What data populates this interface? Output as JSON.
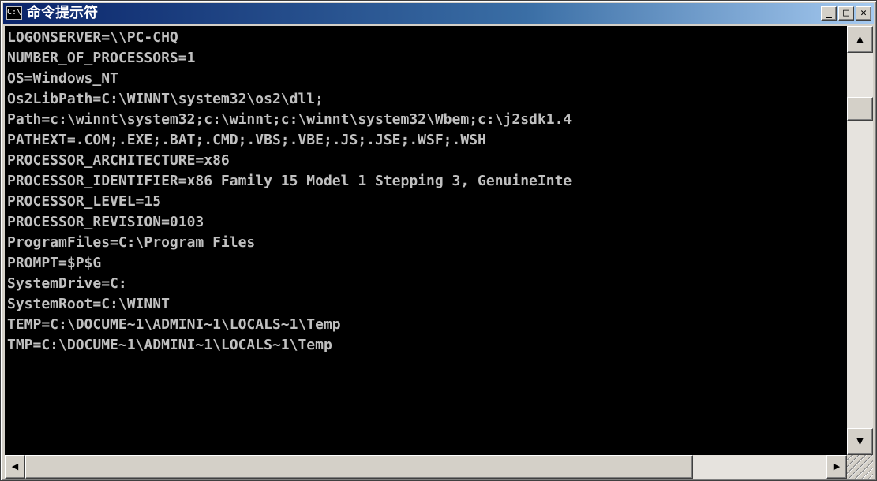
{
  "window": {
    "title": "命令提示符",
    "icon": "cmd-icon",
    "icon_glyph": "C:\\",
    "controls": {
      "minimize": "_",
      "maximize": "□",
      "close": "✕"
    }
  },
  "console": {
    "text_color": "#c0c0c0",
    "background": "#000000",
    "lines": [
      "LOGONSERVER=\\\\PC-CHQ",
      "NUMBER_OF_PROCESSORS=1",
      "OS=Windows_NT",
      "Os2LibPath=C:\\WINNT\\system32\\os2\\dll;",
      "Path=c:\\winnt\\system32;c:\\winnt;c:\\winnt\\system32\\Wbem;c:\\j2sdk1.4",
      "PATHEXT=.COM;.EXE;.BAT;.CMD;.VBS;.VBE;.JS;.JSE;.WSF;.WSH",
      "PROCESSOR_ARCHITECTURE=x86",
      "PROCESSOR_IDENTIFIER=x86 Family 15 Model 1 Stepping 3, GenuineInte",
      "PROCESSOR_LEVEL=15",
      "PROCESSOR_REVISION=0103",
      "ProgramFiles=C:\\Program Files",
      "PROMPT=$P$G",
      "SystemDrive=C:",
      "SystemRoot=C:\\WINNT",
      "TEMP=C:\\DOCUME~1\\ADMINI~1\\LOCALS~1\\Temp",
      "TMP=C:\\DOCUME~1\\ADMINI~1\\LOCALS~1\\Temp"
    ]
  },
  "scrollbars": {
    "up": "▲",
    "down": "▼",
    "left": "◀",
    "right": "▶"
  }
}
